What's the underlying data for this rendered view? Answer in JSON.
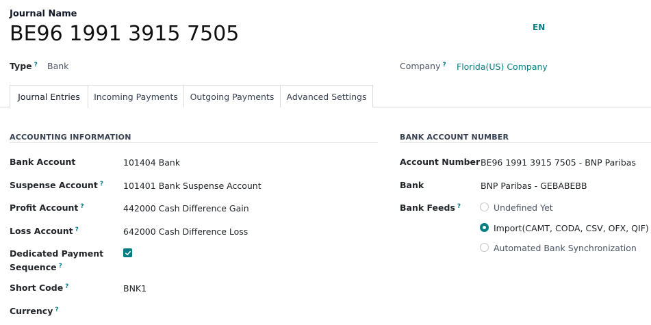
{
  "header": {
    "journal_label": "Journal Name",
    "journal_name": "BE96 1991 3915 7505",
    "lang": "EN"
  },
  "top_fields": {
    "type_label": "Type",
    "type_value": "Bank",
    "company_label": "Company",
    "company_value": "Florida(US) Company",
    "help_mark": "?"
  },
  "tabs": [
    {
      "label": "Journal Entries",
      "active": true
    },
    {
      "label": "Incoming Payments",
      "active": false
    },
    {
      "label": "Outgoing Payments",
      "active": false
    },
    {
      "label": "Advanced Settings",
      "active": false
    }
  ],
  "accounting": {
    "title": "ACCOUNTING INFORMATION",
    "bank_account_label": "Bank Account",
    "bank_account_value": "101404 Bank",
    "suspense_label": "Suspense Account",
    "suspense_value": "101401 Bank Suspense Account",
    "profit_label": "Profit Account",
    "profit_value": "442000 Cash Difference Gain",
    "loss_label": "Loss Account",
    "loss_value": "642000 Cash Difference Loss",
    "dedicated_label_1": "Dedicated Payment",
    "dedicated_label_2": "Sequence",
    "dedicated_checked": true,
    "short_code_label": "Short Code",
    "short_code_value": "BNK1",
    "currency_label": "Currency"
  },
  "bank": {
    "title": "BANK ACCOUNT NUMBER",
    "account_number_label": "Account Number",
    "account_number_value": "BE96 1991 3915 7505 - BNP Paribas",
    "bank_label": "Bank",
    "bank_value": "BNP Paribas - GEBABEBB",
    "feeds_label": "Bank Feeds",
    "feeds_options": [
      {
        "label": "Undefined Yet",
        "checked": false
      },
      {
        "label": "Import(CAMT, CODA, CSV, OFX, QIF)",
        "checked": true
      },
      {
        "label": "Automated Bank Synchronization",
        "checked": false
      }
    ]
  },
  "colors": {
    "accent": "#017e84"
  }
}
